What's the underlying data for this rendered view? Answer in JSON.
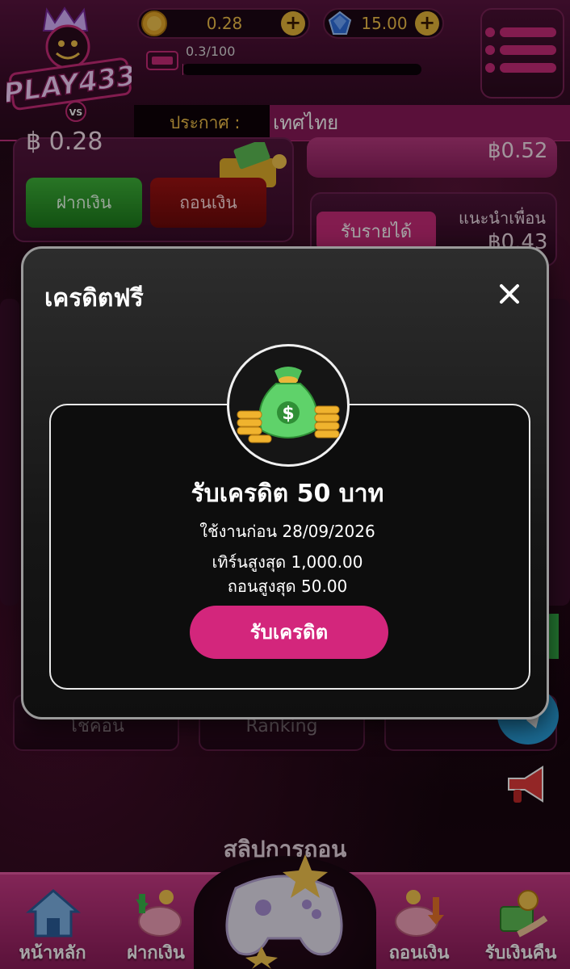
{
  "header": {
    "brand": "PLAY433",
    "coin_balance": "0.28",
    "gem_balance": "15.00",
    "level_progress_text": "0.3/100",
    "level_progress_fraction": 0.003,
    "announce_label": "ประกาศ :",
    "announce_text": "เทศไทย"
  },
  "background": {
    "balance_partial": "฿ 0.28",
    "deposit_label": "ฝากเงิน",
    "withdraw_label": "ถอนเงิน",
    "rebate_value": "฿0.52",
    "referral_button": "รับรายได้",
    "referral_label": "แนะนำเพื่อน",
    "referral_value": "฿0.43",
    "tile_left": "โชคอน",
    "tile_mid": "Ranking",
    "slip_title": "สลิปการถอน"
  },
  "modal": {
    "title": "เครดิตฟรี",
    "credit_title": "รับเครดิต 50 บาท",
    "expiry": "ใช้งานก่อน 28/09/2026",
    "max_turnover": "เทิร์นสูงสุด 1,000.00",
    "max_withdraw": "ถอนสูงสุด 50.00",
    "claim_button": "รับเครดิต"
  },
  "bottom_nav": {
    "items": [
      {
        "label": "หน้าหลัก",
        "icon": "house-icon"
      },
      {
        "label": "ฝากเงิน",
        "icon": "piggy-bank-deposit-icon"
      },
      {
        "label": "ถอนเงิน",
        "icon": "piggy-bank-withdraw-icon"
      },
      {
        "label": "รับเงินคืน",
        "icon": "cashback-hand-icon"
      }
    ]
  },
  "colors": {
    "accent_pink": "#d3267c",
    "gold": "#f3c24a",
    "deposit_green": "#3fb43a",
    "withdraw_red": "#a11212"
  }
}
